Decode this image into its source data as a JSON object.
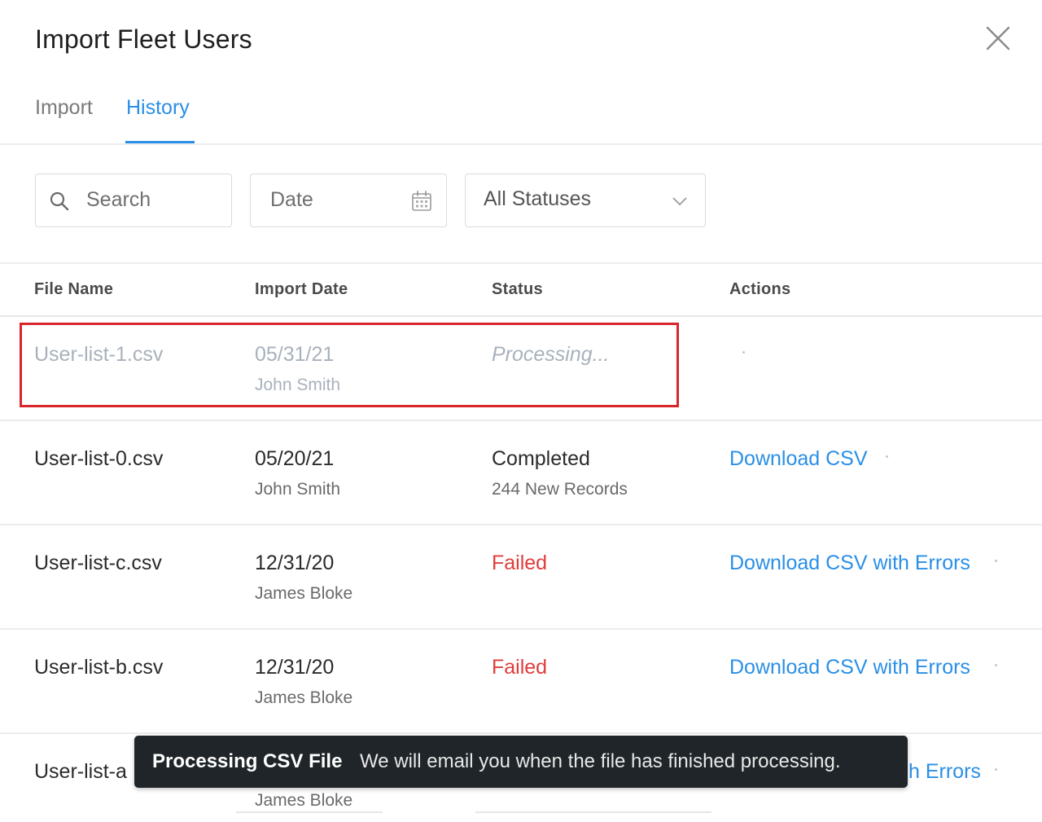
{
  "dialog": {
    "title": "Import Fleet Users"
  },
  "tabs": [
    {
      "label": "Import",
      "active": false
    },
    {
      "label": "History",
      "active": true
    }
  ],
  "filters": {
    "search_placeholder": "Search",
    "date_placeholder": "Date",
    "status_selected": "All Statuses"
  },
  "table": {
    "headers": [
      "File Name",
      "Import Date",
      "Status",
      "Actions"
    ],
    "rows": [
      {
        "file": "User-list-1.csv",
        "date": "05/31/21",
        "user": "John Smith",
        "status": "Processing...",
        "status_detail": "",
        "action": ""
      },
      {
        "file": "User-list-0.csv",
        "date": "05/20/21",
        "user": "John Smith",
        "status": "Completed",
        "status_detail": "244 New Records",
        "action": "Download CSV"
      },
      {
        "file": "User-list-c.csv",
        "date": "12/31/20",
        "user": "James Bloke",
        "status": "Failed",
        "status_detail": "",
        "action": "Download CSV with Errors"
      },
      {
        "file": "User-list-b.csv",
        "date": "12/31/20",
        "user": "James Bloke",
        "status": "Failed",
        "status_detail": "",
        "action": "Download CSV with Errors"
      },
      {
        "file": "User-list-a",
        "date": "",
        "user": "James Bloke",
        "status": "",
        "status_detail": "",
        "action": "h Errors"
      }
    ]
  },
  "toast": {
    "title": "Processing CSV File",
    "message": "We will email you when the file has finished processing."
  },
  "colors": {
    "accent": "#2a8fe6",
    "failed": "#e23b3b",
    "highlight_border": "#d9252c",
    "toast_bg": "#1f2529"
  },
  "icons": {
    "close": "close-icon",
    "search": "search-icon",
    "date": "calendar-icon",
    "status": "chevron-down-icon"
  }
}
